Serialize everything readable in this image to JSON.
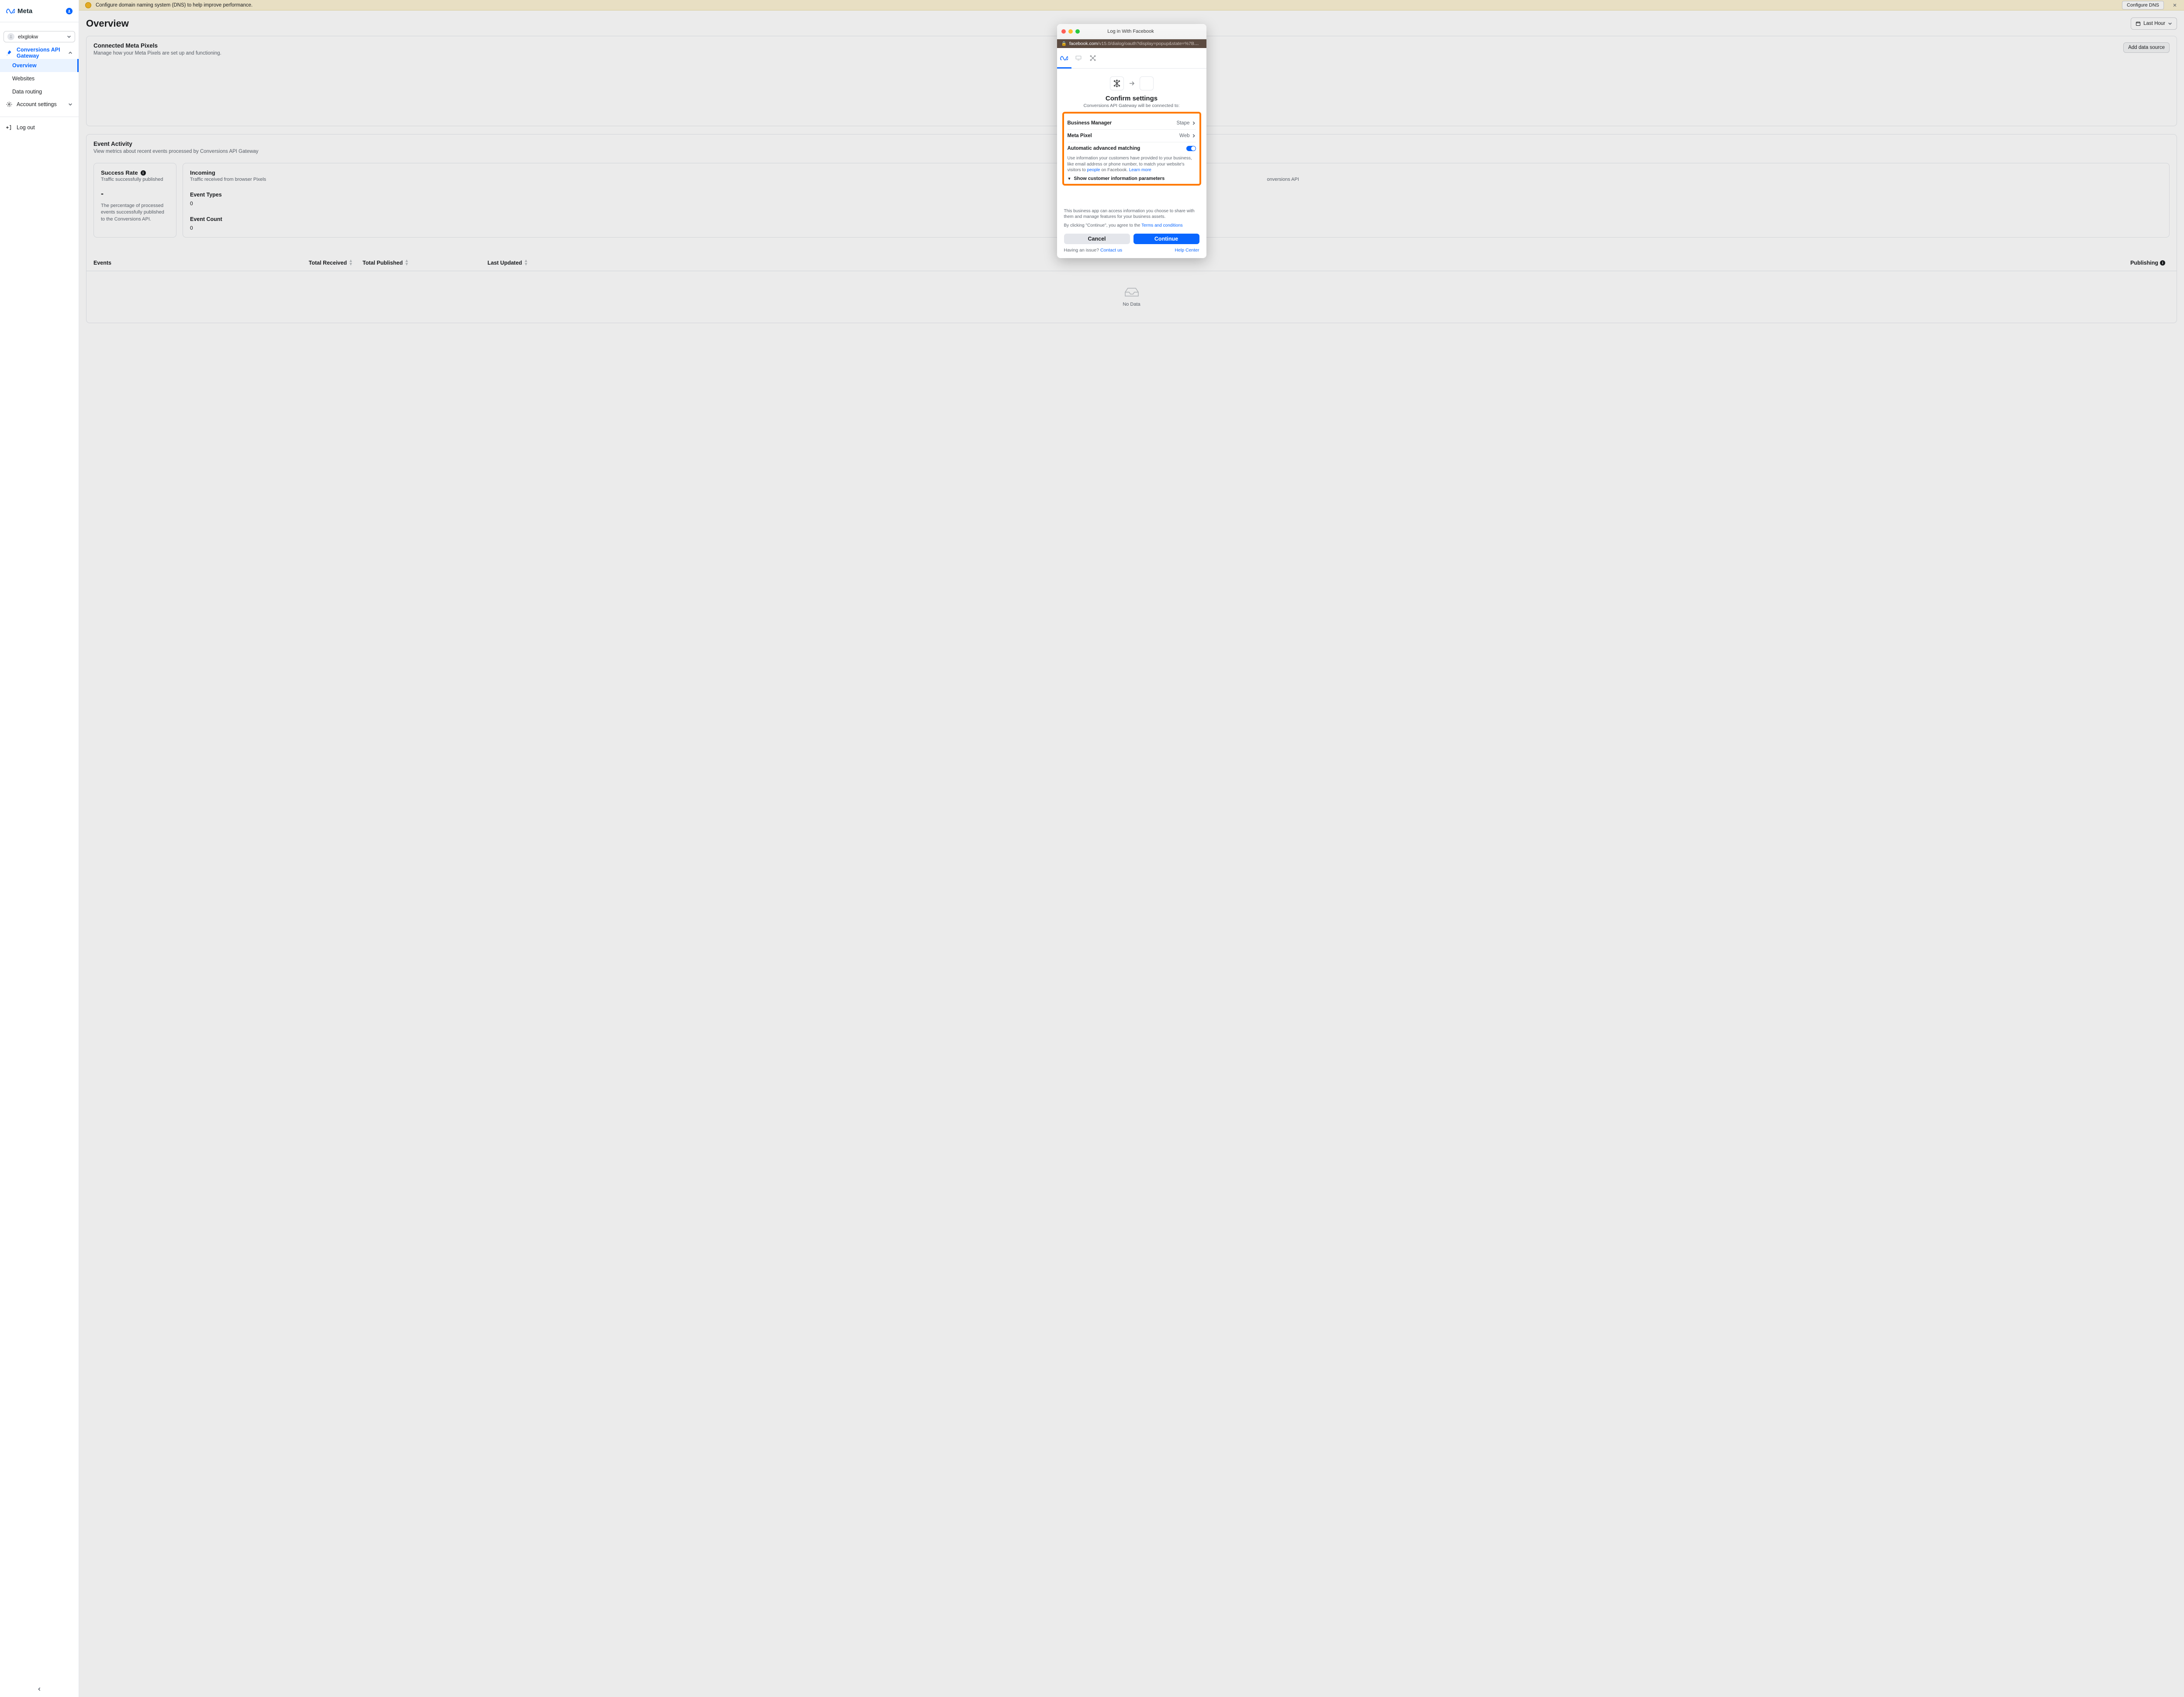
{
  "brand": "Meta",
  "org_name": "elxglokw",
  "sidebar": {
    "section_label": "Conversions API Gateway",
    "items": [
      "Overview",
      "Websites",
      "Data routing"
    ],
    "account_settings": "Account settings",
    "logout": "Log out"
  },
  "banner": {
    "text": "Configure domain naming system (DNS) to help improve performance.",
    "cta": "Configure DNS"
  },
  "page": {
    "title": "Overview",
    "timerange": "Last Hour"
  },
  "card_pixels": {
    "title": "Connected Meta Pixels",
    "subtitle": "Manage how your Meta Pixels are set up and functioning.",
    "action": "Add data source"
  },
  "card_activity": {
    "title": "Event Activity",
    "subtitle": "View metrics about recent events processed by Conversions API Gateway"
  },
  "metrics": {
    "success": {
      "title": "Success Rate",
      "sub": "Traffic successfully published",
      "value": "-",
      "hint": "The percentage of processed events successfully published to the Conversions API."
    },
    "incoming": {
      "title": "Incoming",
      "sub": "Traffic received from browser Pixels",
      "event_types_label": "Event Types",
      "event_types_value": "0",
      "event_count_label": "Event Count",
      "event_count_value": "0"
    },
    "outgoing": {
      "suffix_text": "onversions API"
    }
  },
  "table": {
    "cols": {
      "events": "Events",
      "received": "Total Received",
      "published": "Total Published",
      "updated": "Last Updated",
      "publishing": "Publishing"
    },
    "empty": "No Data"
  },
  "popup": {
    "window_title": "Log in With Facebook",
    "url_host": "facebook.com",
    "url_path": "/v15.0/dialog/oauth?display=popup&state=%7B%uid%3A%88f…",
    "confirm_title": "Confirm settings",
    "confirm_sub": "Conversions API Gateway will be connected to:",
    "rows": {
      "bm_label": "Business Manager",
      "bm_value": "Stape",
      "pixel_label": "Meta Pixel",
      "pixel_value": "Web",
      "aam_label": "Automatic advanced matching",
      "aam_caption_pre": "Use information your customers have provided to your business, like email address or phone number, to match your website's visitors to ",
      "aam_caption_linkword": "people",
      "aam_caption_post": " on Facebook. ",
      "aam_learn": "Learn more",
      "expand": "Show customer information parameters"
    },
    "disclaimer1": "This business app can access information you choose to share with them and manage features for your business assets.",
    "disclaimer2_pre": "By clicking \"Continue\", you agree to the ",
    "disclaimer2_link": "Terms and conditions",
    "cancel": "Cancel",
    "continue": "Continue",
    "issue_pre": "Having an issue? ",
    "contact": "Contact us",
    "help": "Help Center"
  }
}
